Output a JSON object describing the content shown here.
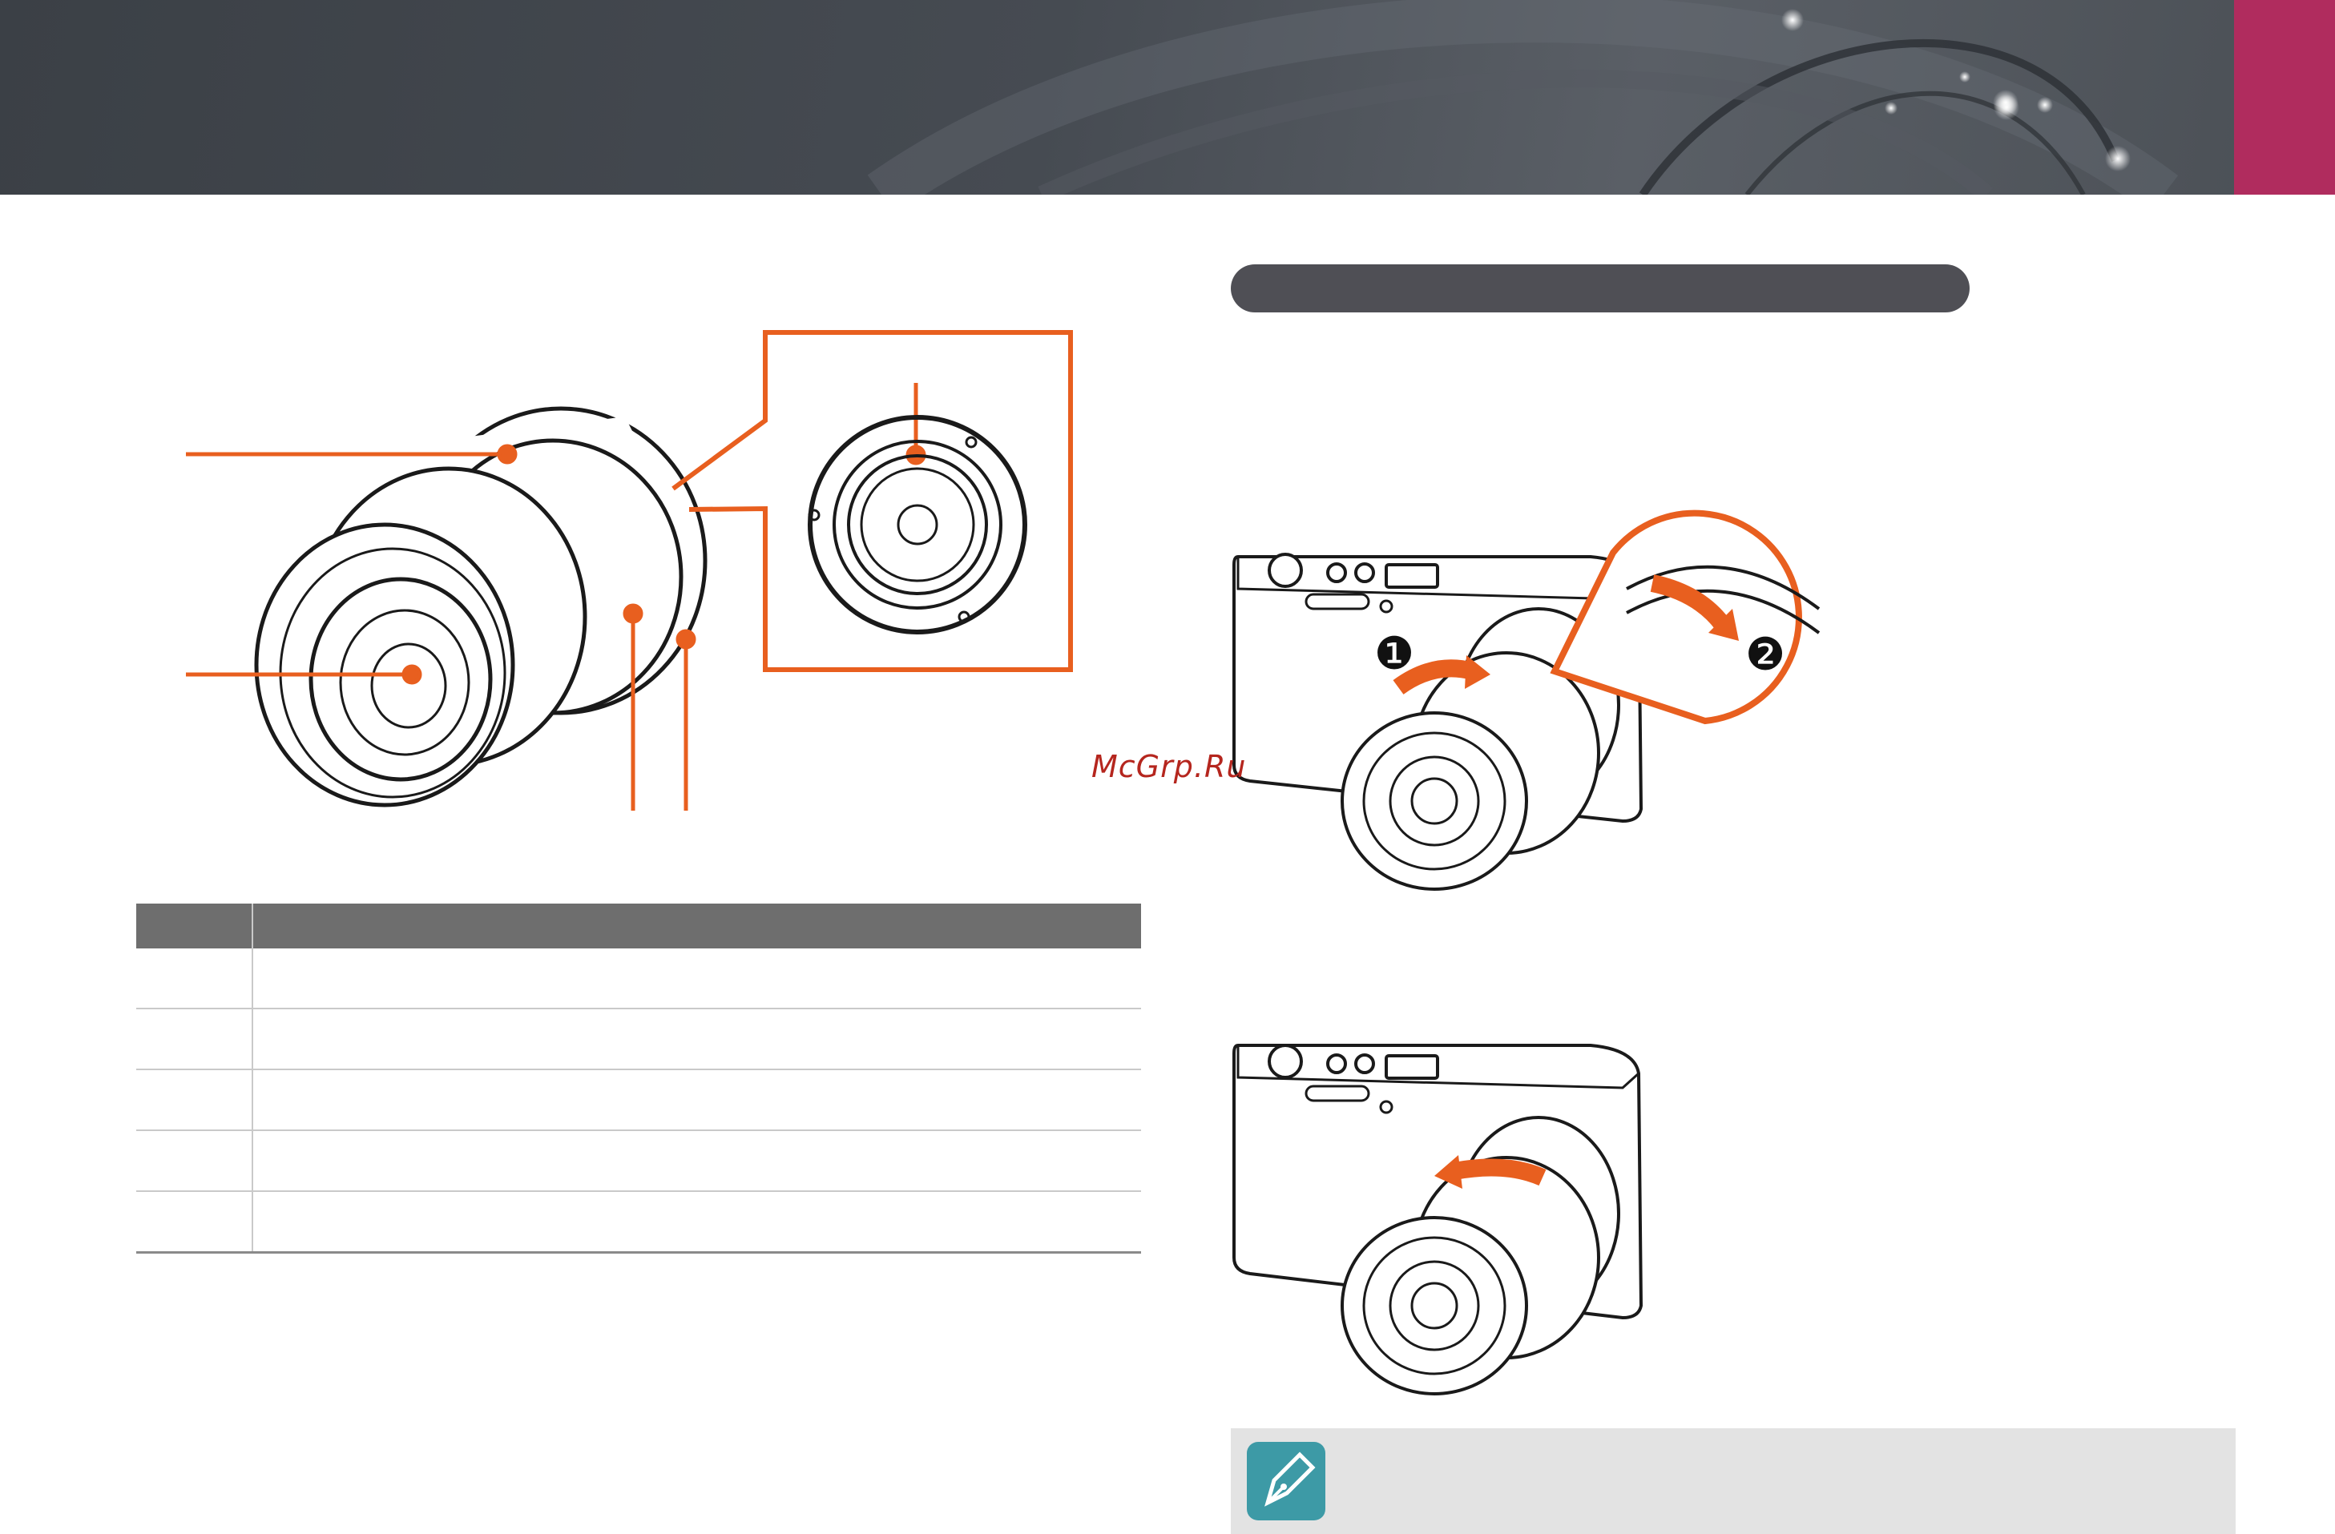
{
  "header": {
    "accent_color": "#b02c5e",
    "banner_color": "#44494f"
  },
  "lens_diagram": {
    "callout_color": "#e85f1f"
  },
  "parts_table": {
    "rows": 5
  },
  "section": {
    "pill_color": "#4f4f55"
  },
  "steps": {
    "step1_marker": "❶",
    "step2_marker": "❷"
  },
  "watermark": {
    "text": "McGrp.Ru"
  },
  "note": {
    "icon": "pen-note-icon",
    "icon_color": "#3d9aa6"
  }
}
